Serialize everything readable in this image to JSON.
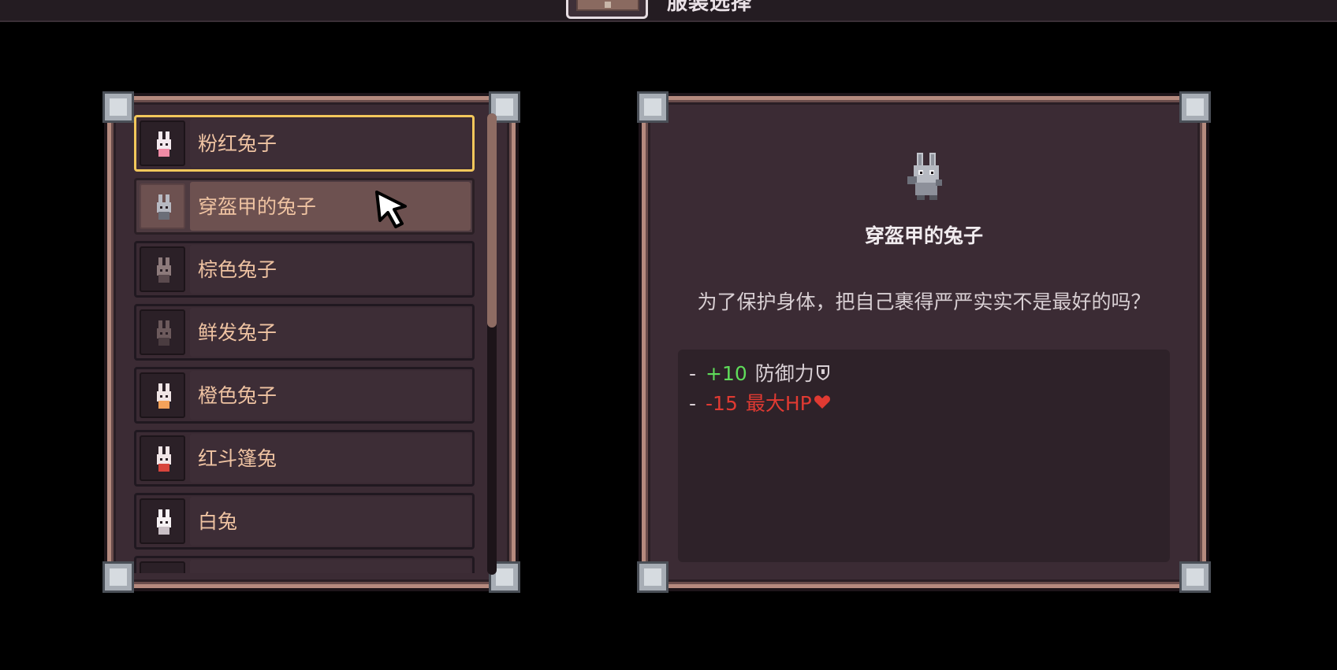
{
  "topbar": {
    "title": "服装选择",
    "icon": "chest-icon"
  },
  "skin_list": {
    "selected_index": 0,
    "hovered_index": 1,
    "scroll_position": 0.0,
    "items": [
      {
        "label": "粉红兔子",
        "icon": "pink-bunny-icon",
        "color": "#f3e9ee",
        "accent": "#f08aa5"
      },
      {
        "label": "穿盔甲的兔子",
        "icon": "armored-bunny-icon",
        "color": "#b7b9c2",
        "accent": "#6b6e78"
      },
      {
        "label": "棕色兔子",
        "icon": "brown-bunny-icon",
        "color": "#8d7a7b",
        "accent": "#5b4a4e"
      },
      {
        "label": "鲜发兔子",
        "icon": "shaggy-bunny-icon",
        "color": "#6c5a5c",
        "accent": "#4a3c40"
      },
      {
        "label": "橙色兔子",
        "icon": "orange-bunny-icon",
        "color": "#f0e5e6",
        "accent": "#f5a25a"
      },
      {
        "label": "红斗篷兔",
        "icon": "red-hood-bunny-icon",
        "color": "#f2e6e8",
        "accent": "#d8443c"
      },
      {
        "label": "白兔",
        "icon": "white-bunny-icon",
        "color": "#f6f1f3",
        "accent": "#c9bfc5"
      }
    ]
  },
  "detail": {
    "name": "穿盔甲的兔子",
    "description": "为了保护身体，把自己裹得严严实实不是最好的吗？",
    "sprite": "armored-bunny-sprite",
    "stats": [
      {
        "dash": "-",
        "value": "+10",
        "name": "防御力",
        "icon": "shield-icon",
        "type": "positive"
      },
      {
        "dash": "-",
        "value": "-15",
        "name": "最大HP",
        "icon": "heart-icon",
        "type": "negative"
      }
    ]
  },
  "colors": {
    "selected_border": "#f2c75b",
    "item_text": "#efc3a2",
    "positive_stat": "#5fdc5a",
    "negative_stat": "#e03a32"
  }
}
